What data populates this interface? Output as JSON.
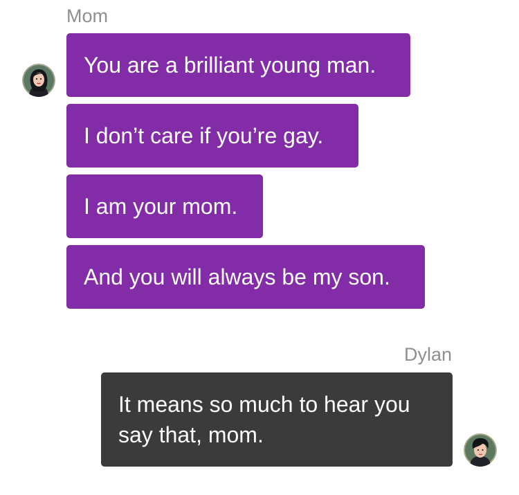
{
  "conversation": {
    "mom": {
      "name": "Mom",
      "messages": [
        "You are a brilliant young man.",
        "I don’t care if you’re gay.",
        "I am your mom.",
        "And you will always be my son."
      ],
      "bubble_color": "#832ca8"
    },
    "dylan": {
      "name": "Dylan",
      "messages": [
        "It means so much to hear you say that, mom."
      ],
      "bubble_color": "#3b3b3b"
    }
  },
  "icons": {
    "mom_avatar": "mom-avatar-icon",
    "dylan_avatar": "dylan-avatar-icon"
  }
}
